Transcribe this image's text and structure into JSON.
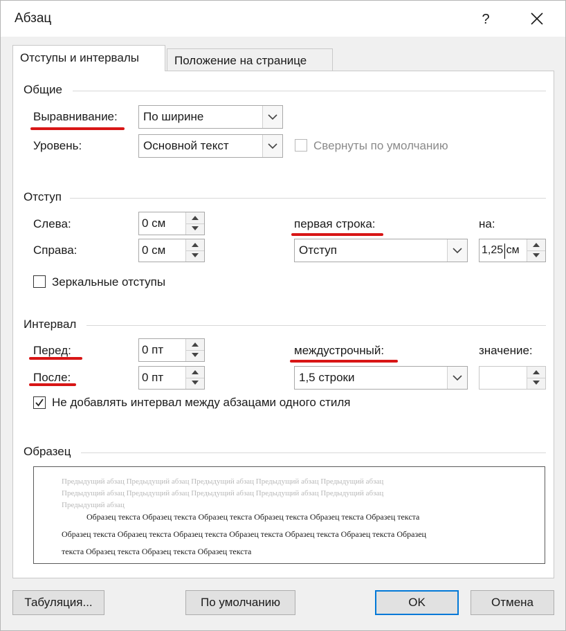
{
  "dialog": {
    "title": "Абзац",
    "help": "?"
  },
  "tabs": [
    {
      "label": "Отступы и интервалы",
      "active": true
    },
    {
      "label": "Положение на странице",
      "active": false
    }
  ],
  "general": {
    "title": "Общие",
    "alignment_label": "Выравнивание:",
    "alignment_value": "По ширине",
    "level_label": "Уровень:",
    "level_value": "Основной текст",
    "collapsed_label": "Свернуты по умолчанию",
    "collapsed_checked": false
  },
  "indent": {
    "title": "Отступ",
    "left_label": "Слева:",
    "left_value": "0 см",
    "right_label": "Справа:",
    "right_value": "0 см",
    "first_line_label": "первая строка:",
    "first_line_value": "Отступ",
    "by_label": "на:",
    "by_value": "1,25 см",
    "mirror_label": "Зеркальные отступы",
    "mirror_checked": false
  },
  "spacing": {
    "title": "Интервал",
    "before_label": "Перед:",
    "before_value": "0 пт",
    "after_label": "После:",
    "after_value": "0 пт",
    "line_label": "междустрочный:",
    "line_value": "1,5 строки",
    "value_label": "значение:",
    "value_value": "",
    "no_space_label": "Не добавлять интервал между абзацами одного стиля",
    "no_space_checked": true
  },
  "preview": {
    "title": "Образец",
    "grey_lines": [
      "Предыдущий абзац Предыдущий абзац Предыдущий абзац Предыдущий абзац Предыдущий абзац",
      "Предыдущий абзац Предыдущий абзац Предыдущий абзац Предыдущий абзац Предыдущий абзац",
      "Предыдущий абзац"
    ],
    "sample_lines": [
      "Образец текста Образец текста Образец текста Образец текста Образец текста Образец текста",
      "Образец текста Образец текста Образец текста Образец текста Образец текста Образец текста Образец",
      "текста Образец текста Образец текста Образец текста"
    ]
  },
  "buttons": {
    "tabs": "Табуляция...",
    "default": "По умолчанию",
    "ok": "OK",
    "cancel": "Отмена"
  },
  "colors": {
    "accent": "#0078d7",
    "annotation": "#d81616"
  },
  "icons": [
    "close-icon",
    "chevron-down-icon",
    "spin-up-icon",
    "spin-down-icon",
    "checkmark-icon"
  ]
}
